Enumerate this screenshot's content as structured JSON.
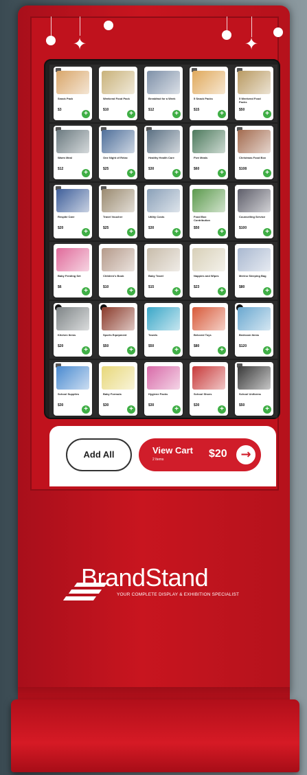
{
  "colors": {
    "kiosk_red": "#c8151f",
    "add_green": "#3fae45",
    "cart_red": "#d01d2a"
  },
  "products": [
    [
      {
        "name": "Snack Pack",
        "price": "$3",
        "color": "#d9a66a",
        "badge": "tag"
      },
      {
        "name": "Weekend Food Pack",
        "price": "$10",
        "color": "#c9b27a",
        "badge": "none"
      },
      {
        "name": "Breakfast for a Week",
        "price": "$12",
        "color": "#7e90a8",
        "badge": "none"
      },
      {
        "name": "5 Snack Packs",
        "price": "$15",
        "color": "#e0a95c",
        "badge": "tag"
      },
      {
        "name": "5 Weekend Food Packs",
        "price": "$50",
        "color": "#b99a62",
        "badge": "tag"
      }
    ],
    [
      {
        "name": "Warm Meal",
        "price": "$12",
        "color": "#6b7a80",
        "badge": "tag"
      },
      {
        "name": "One Night of Relax",
        "price": "$25",
        "color": "#4f6f9a",
        "badge": "tag"
      },
      {
        "name": "Healthy Health Care",
        "price": "$30",
        "color": "#5a6f82",
        "badge": "tag"
      },
      {
        "name": "Five Meals",
        "price": "$60",
        "color": "#4d7a5d",
        "badge": "none"
      },
      {
        "name": "Christmas Food Box",
        "price": "$108",
        "color": "#a36b4f",
        "badge": "tag"
      }
    ],
    [
      {
        "name": "Respite Care",
        "price": "$20",
        "color": "#3f5f9a",
        "badge": "tag"
      },
      {
        "name": "Travel Voucher",
        "price": "$25",
        "color": "#9a8a70",
        "badge": "tag"
      },
      {
        "name": "Utility Costs",
        "price": "$30",
        "color": "#8aa0b8",
        "badge": "none"
      },
      {
        "name": "Food Box Contribution",
        "price": "$50",
        "color": "#5c9a4d",
        "badge": "none"
      },
      {
        "name": "Counselling Service",
        "price": "$100",
        "color": "#5e5e6a",
        "badge": "none"
      }
    ],
    [
      {
        "name": "Baby Feeding Set",
        "price": "$6",
        "color": "#e06a9a",
        "badge": "none"
      },
      {
        "name": "Children's Book",
        "price": "$10",
        "color": "#b59a8a",
        "badge": "none"
      },
      {
        "name": "Baby Towel",
        "price": "$15",
        "color": "#c8bcaa",
        "badge": "none"
      },
      {
        "name": "Nappies and Wipes",
        "price": "$23",
        "color": "#d8d0b8",
        "badge": "none"
      },
      {
        "name": "Merino Sleeping Bag",
        "price": "$80",
        "color": "#a9b8d0",
        "badge": "none"
      }
    ],
    [
      {
        "name": "Kitchen Items",
        "price": "$20",
        "color": "#7f8587",
        "badge": "dot"
      },
      {
        "name": "Sports Equipment",
        "price": "$50",
        "color": "#8a3a2a",
        "badge": "dot"
      },
      {
        "name": "Towels",
        "price": "$50",
        "color": "#3aa7c8",
        "badge": "none"
      },
      {
        "name": "Beloved Toys",
        "price": "$80",
        "color": "#d85a3a",
        "badge": "none"
      },
      {
        "name": "Bedroom Items",
        "price": "$120",
        "color": "#6aa8d0",
        "badge": "dot"
      }
    ],
    [
      {
        "name": "School Supplies",
        "price": "$30",
        "color": "#4a8ad0",
        "badge": "tag"
      },
      {
        "name": "Baby Formula",
        "price": "$30",
        "color": "#e8d87a",
        "badge": "none"
      },
      {
        "name": "Hygiene Packs",
        "price": "$30",
        "color": "#d86aa8",
        "badge": "none"
      },
      {
        "name": "School Shoes",
        "price": "$30",
        "color": "#c83a3a",
        "badge": "none"
      },
      {
        "name": "School Uniforms",
        "price": "$50",
        "color": "#3a3a3a",
        "badge": "tag"
      }
    ]
  ],
  "cart": {
    "add_all_label": "Add All",
    "view_cart_label": "View Cart",
    "item_count": "2 Items",
    "total": "$20",
    "arrow_icon": "→"
  },
  "brand": {
    "name": "BrandStand",
    "tagline": "YOUR COMPLETE DISPLAY & EXHIBITION SPECIALIST"
  }
}
